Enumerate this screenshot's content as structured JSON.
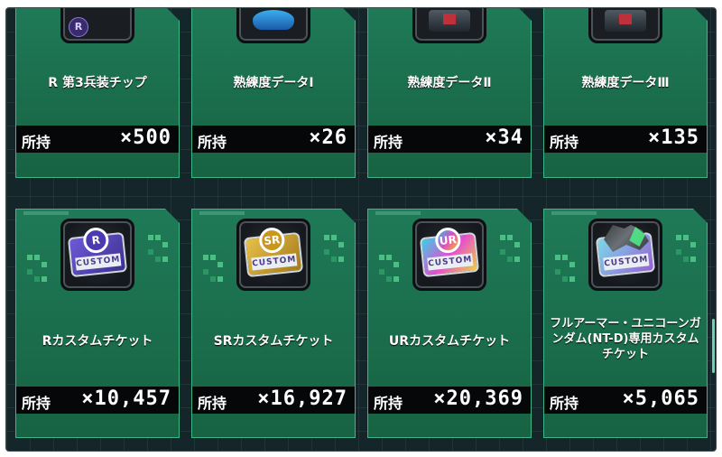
{
  "hold_label": "所持",
  "items": [
    {
      "name": "R 第3兵装チップ",
      "count": "×500",
      "icon": "r-equipment-chip-icon"
    },
    {
      "name": "熟練度データⅠ",
      "count": "×26",
      "icon": "proficiency-data-1-icon"
    },
    {
      "name": "熟練度データⅡ",
      "count": "×34",
      "icon": "proficiency-data-2-icon"
    },
    {
      "name": "熟練度データⅢ",
      "count": "×135",
      "icon": "proficiency-data-3-icon"
    },
    {
      "name": "Rカスタムチケット",
      "count": "×10,457",
      "icon": "r-custom-ticket-icon",
      "medal": "R"
    },
    {
      "name": "SRカスタムチケット",
      "count": "×16,927",
      "icon": "sr-custom-ticket-icon",
      "medal": "SR"
    },
    {
      "name": "URカスタムチケット",
      "count": "×20,369",
      "icon": "ur-custom-ticket-icon",
      "medal": "UR"
    },
    {
      "name": "フルアーマー・ユニコーンガンダム(NT-D)専用カスタムチケット",
      "count": "×5,065",
      "icon": "unicorn-custom-ticket-icon"
    }
  ],
  "ticket_banner": "CUSTOM",
  "chip_badge": "R",
  "colors": {
    "card": "#1d7451",
    "card_border": "#3fb585",
    "hold_bar": "#050708",
    "background": "#14262a"
  }
}
